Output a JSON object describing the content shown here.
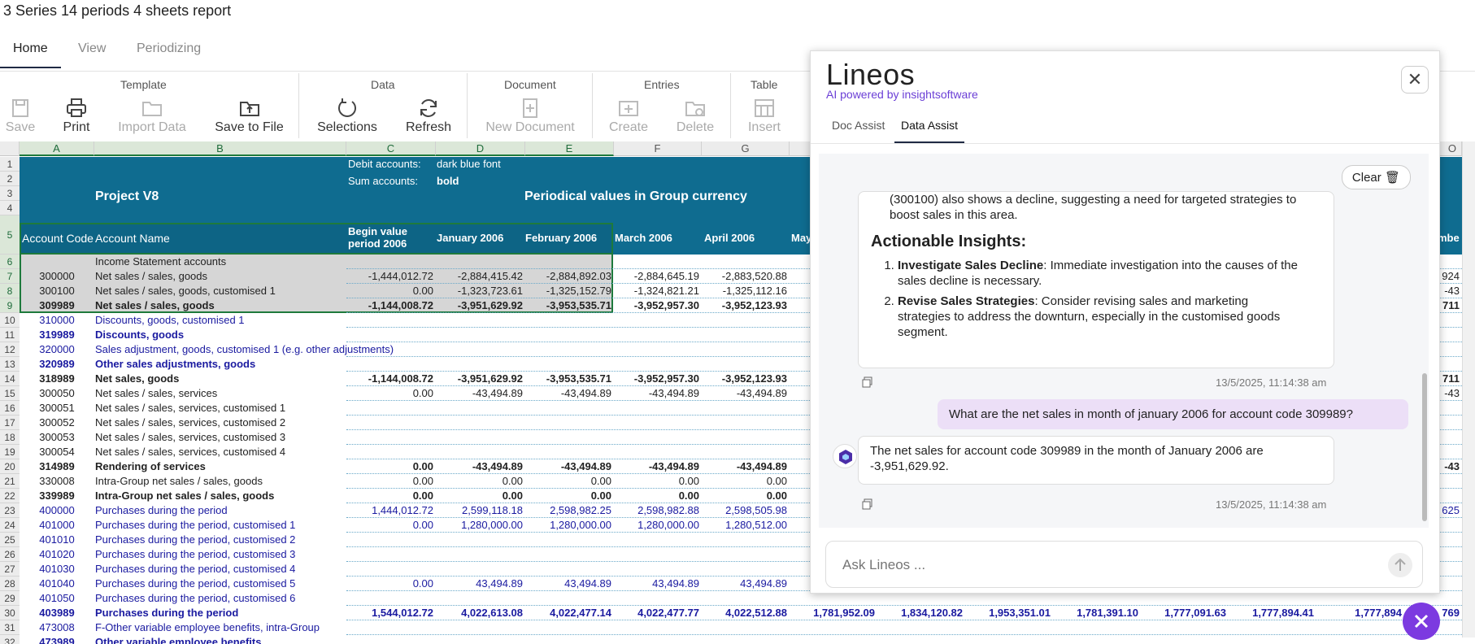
{
  "window": {
    "title": "3 Series 14 periods 4 sheets report"
  },
  "tabs": [
    {
      "label": "Home"
    },
    {
      "label": "View"
    },
    {
      "label": "Periodizing"
    }
  ],
  "ribbon": {
    "groups": {
      "template": "Template",
      "data": "Data",
      "document": "Document",
      "entries": "Entries",
      "table": "Table"
    },
    "buttons": {
      "save": "Save",
      "print": "Print",
      "import_data": "Import Data",
      "save_to_file": "Save to File",
      "selections": "Selections",
      "refresh": "Refresh",
      "new_document": "New Document",
      "create": "Create",
      "delete": "Delete",
      "insert": "Insert"
    }
  },
  "sheet": {
    "columns": [
      "A",
      "B",
      "C",
      "D",
      "E",
      "F",
      "G",
      "O"
    ],
    "rows": [
      "1",
      "2",
      "3",
      "4",
      "5",
      "6",
      "7",
      "8",
      "9",
      "10",
      "11",
      "12",
      "13",
      "14",
      "15",
      "16",
      "17",
      "18",
      "19",
      "20",
      "21",
      "22",
      "23",
      "24",
      "25",
      "26",
      "27",
      "28",
      "29",
      "30",
      "31",
      "32"
    ],
    "header": {
      "project": "Project V8",
      "debit_label": "Debit accounts:",
      "debit_value": "dark blue font",
      "sum_label": "Sum accounts:",
      "sum_value": "bold",
      "periodical": "Periodical values in Group currency",
      "account_code": "Account Code",
      "account_name": "Account Name",
      "begin_value_1": "Begin value",
      "begin_value_2": "period 2006",
      "jan": "January 2006",
      "feb": "February 2006",
      "mar": "March 2006",
      "apr": "April 2006",
      "may": "May",
      "last": "mbe"
    },
    "data_rows": [
      {
        "code": "",
        "name": "Income Statement accounts",
        "c": "",
        "d": "",
        "e": "",
        "f": "",
        "g": "",
        "o": "",
        "style": "grey"
      },
      {
        "code": "300000",
        "name": "Net sales / sales, goods",
        "c": "-1,444,012.72",
        "d": "-2,884,415.42",
        "e": "-2,884,892.03",
        "f": "-2,884,645.19",
        "g": "-2,883,520.88",
        "o": "924",
        "style": "grey"
      },
      {
        "code": "300100",
        "name": "Net sales / sales, goods, customised 1",
        "c": "0.00",
        "d": "-1,323,723.61",
        "e": "-1,325,152.79",
        "f": "-1,324,821.21",
        "g": "-1,325,112.16",
        "o": "-43",
        "style": "grey"
      },
      {
        "code": "309989",
        "name": "Net sales / sales, goods",
        "c": "-1,144,008.72",
        "d": "-3,951,629.92",
        "e": "-3,953,535.71",
        "f": "-3,952,957.30",
        "g": "-3,952,123.93",
        "o": "711",
        "style": "greybold"
      },
      {
        "code": "310000",
        "name": "Discounts, goods, customised 1",
        "c": "",
        "d": "",
        "e": "",
        "f": "",
        "g": "",
        "o": "",
        "style": "blue"
      },
      {
        "code": "319989",
        "name": "Discounts, goods",
        "c": "",
        "d": "",
        "e": "",
        "f": "",
        "g": "",
        "o": "",
        "style": "bluebold"
      },
      {
        "code": "320000",
        "name": "Sales adjustment, goods, customised 1 (e.g. other adjustments)",
        "c": "",
        "d": "",
        "e": "",
        "f": "",
        "g": "",
        "o": "",
        "style": "blue"
      },
      {
        "code": "320989",
        "name": "Other sales adjustments, goods",
        "c": "",
        "d": "",
        "e": "",
        "f": "",
        "g": "",
        "o": "",
        "style": "bluebold"
      },
      {
        "code": "318989",
        "name": "Net sales, goods",
        "c": "-1,144,008.72",
        "d": "-3,951,629.92",
        "e": "-3,953,535.71",
        "f": "-3,952,957.30",
        "g": "-3,952,123.93",
        "o": "711",
        "style": "bold"
      },
      {
        "code": "300050",
        "name": "Net sales / sales, services",
        "c": "0.00",
        "d": "-43,494.89",
        "e": "-43,494.89",
        "f": "-43,494.89",
        "g": "-43,494.89",
        "o": "-43",
        "style": "normal"
      },
      {
        "code": "300051",
        "name": "Net sales / sales, services, customised 1",
        "c": "",
        "d": "",
        "e": "",
        "f": "",
        "g": "",
        "o": "",
        "style": "normal"
      },
      {
        "code": "300052",
        "name": "Net sales / sales, services, customised 2",
        "c": "",
        "d": "",
        "e": "",
        "f": "",
        "g": "",
        "o": "",
        "style": "normal"
      },
      {
        "code": "300053",
        "name": "Net sales / sales, services, customised 3",
        "c": "",
        "d": "",
        "e": "",
        "f": "",
        "g": "",
        "o": "",
        "style": "normal"
      },
      {
        "code": "300054",
        "name": "Net sales / sales, services, customised 4",
        "c": "",
        "d": "",
        "e": "",
        "f": "",
        "g": "",
        "o": "",
        "style": "normal"
      },
      {
        "code": "314989",
        "name": "Rendering of services",
        "c": "0.00",
        "d": "-43,494.89",
        "e": "-43,494.89",
        "f": "-43,494.89",
        "g": "-43,494.89",
        "o": "-43",
        "style": "bold"
      },
      {
        "code": "330008",
        "name": "Intra-Group net sales / sales, goods",
        "c": "0.00",
        "d": "0.00",
        "e": "0.00",
        "f": "0.00",
        "g": "0.00",
        "o": "",
        "style": "normal"
      },
      {
        "code": "339989",
        "name": "Intra-Group net sales / sales, goods",
        "c": "0.00",
        "d": "0.00",
        "e": "0.00",
        "f": "0.00",
        "g": "0.00",
        "o": "",
        "style": "bold"
      },
      {
        "code": "400000",
        "name": "Purchases during the period",
        "c": "1,444,012.72",
        "d": "2,599,118.18",
        "e": "2,598,982.25",
        "f": "2,598,982.88",
        "g": "2,598,505.98",
        "o": "625",
        "style": "blue"
      },
      {
        "code": "401000",
        "name": "Purchases during the period, customised 1",
        "c": "0.00",
        "d": "1,280,000.00",
        "e": "1,280,000.00",
        "f": "1,280,000.00",
        "g": "1,280,512.00",
        "o": "",
        "style": "blue"
      },
      {
        "code": "401010",
        "name": "Purchases during the period, customised 2",
        "c": "",
        "d": "",
        "e": "",
        "f": "",
        "g": "",
        "o": "",
        "style": "blue"
      },
      {
        "code": "401020",
        "name": "Purchases during the period, customised 3",
        "c": "",
        "d": "",
        "e": "",
        "f": "",
        "g": "",
        "o": "",
        "style": "blue"
      },
      {
        "code": "401030",
        "name": "Purchases during the period, customised 4",
        "c": "",
        "d": "",
        "e": "",
        "f": "",
        "g": "",
        "o": "",
        "style": "blue"
      },
      {
        "code": "401040",
        "name": "Purchases during the period, customised 5",
        "c": "0.00",
        "d": "43,494.89",
        "e": "43,494.89",
        "f": "43,494.89",
        "g": "43,494.89",
        "o": "",
        "style": "blue"
      },
      {
        "code": "401050",
        "name": "Purchases during the period, customised 6",
        "c": "",
        "d": "",
        "e": "",
        "f": "",
        "g": "",
        "o": "",
        "style": "blue"
      },
      {
        "code": "403989",
        "name": "Purchases during the period",
        "c": "1,544,012.72",
        "d": "4,022,613.08",
        "e": "4,022,477.14",
        "f": "4,022,477.77",
        "g": "4,022,512.88",
        "o": "769",
        "style": "bluebold"
      },
      {
        "code": "473008",
        "name": "F-Other variable employee benefits, intra-Group",
        "c": "",
        "d": "",
        "e": "",
        "f": "",
        "g": "",
        "o": "",
        "style": "blue"
      },
      {
        "code": "473989",
        "name": "Other variable employee benefits",
        "c": "",
        "d": "",
        "e": "",
        "f": "",
        "g": "",
        "o": "",
        "style": "bluebold"
      }
    ],
    "row30_extra": [
      "1,781,952.09",
      "1,834,120.82",
      "1,953,351.01",
      "1,781,391.10",
      "1,777,091.63",
      "1,777,894.41",
      "1,777,894"
    ]
  },
  "assistant": {
    "logo": "Lineos",
    "subtitle": "AI powered by insightsoftware",
    "tabs": [
      {
        "label": "Doc Assist"
      },
      {
        "label": "Data Assist"
      }
    ],
    "clear_label": "Clear",
    "messages": {
      "partial_text": "(300100) also shows a decline, suggesting a need for targeted strategies to boost sales in this area.",
      "insights_heading": "Actionable Insights:",
      "insight_1_title": "Investigate Sales Decline",
      "insight_1_text": ": Immediate investigation into the causes of the sales decline is necessary.",
      "insight_2_title": "Revise Sales Strategies",
      "insight_2_text": ": Consider revising sales and marketing strategies to address the downturn, especially in the customised goods segment.",
      "timestamp_1": "13/5/2025, 11:14:38 am",
      "user_question": "What are the net sales in month of january 2006 for account code 309989?",
      "bot_answer": "The net sales for account code 309989 in the month of January 2006 are -3,951,629.92.",
      "timestamp_2": "13/5/2025, 11:14:38 am"
    },
    "input_placeholder": "Ask Lineos ..."
  },
  "colors": {
    "header_band": "#0f6c90",
    "accent_purple": "#7c3ae0",
    "user_bubble": "#ecdff7",
    "debit_blue": "#1a1aa0"
  }
}
